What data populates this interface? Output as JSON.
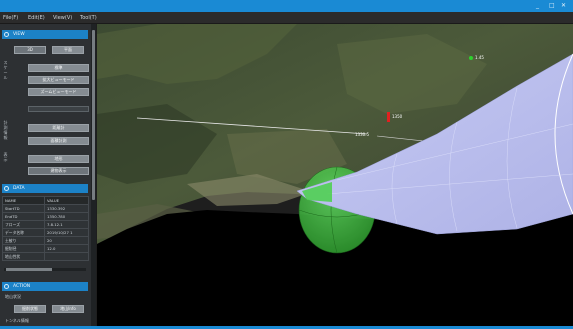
{
  "window": {
    "controls": [
      "_",
      "□",
      "✕"
    ]
  },
  "menu": [
    "File(F)",
    "Edit(E)",
    "View(V)",
    "Tool(T)"
  ],
  "view_panel": {
    "title": "VIEW",
    "mode_buttons": [
      {
        "label": "3D",
        "selected": true
      },
      {
        "label": "平面",
        "selected": false
      }
    ],
    "group1_label": [
      "ス",
      "ケ",
      "ー",
      "ル"
    ],
    "group1_buttons": [
      "標準",
      "拡大ビューモード",
      "ズームビューモード"
    ],
    "group2_label": [
      "計",
      "測",
      "情",
      "報"
    ],
    "group2_buttons": [
      "距離計",
      "面積計測"
    ],
    "group3_label": [
      "表",
      "示"
    ],
    "group3_buttons": [
      "地形",
      "建物表示"
    ]
  },
  "data_panel": {
    "title": "DATA",
    "columns": [
      "NAME",
      "VALUE"
    ],
    "rows": [
      [
        "StartTD",
        "1330.392"
      ],
      [
        "EndTD",
        "1350.780"
      ],
      [
        "フローズ",
        "7.8.12.1"
      ],
      [
        "データ名称",
        "2019/10/27 1"
      ],
      [
        "土被り",
        "20"
      ],
      [
        "掘削径",
        "12.0"
      ],
      [
        "地山性状",
        ""
      ]
    ]
  },
  "action_panel": {
    "title": "ACTION",
    "label": "地山状況",
    "buttons": [
      "掘削状態",
      "地山Info"
    ],
    "footer_label": "トンネル情報"
  },
  "scene": {
    "tunnel_label": "1330.5",
    "marker_red_label": "1350",
    "marker_green_label": "1.45"
  },
  "colors": {
    "accent": "#1a8ad4",
    "tunnel": "#c9cdf6",
    "sphere": "#3cc43c",
    "marker": "#e02020"
  }
}
